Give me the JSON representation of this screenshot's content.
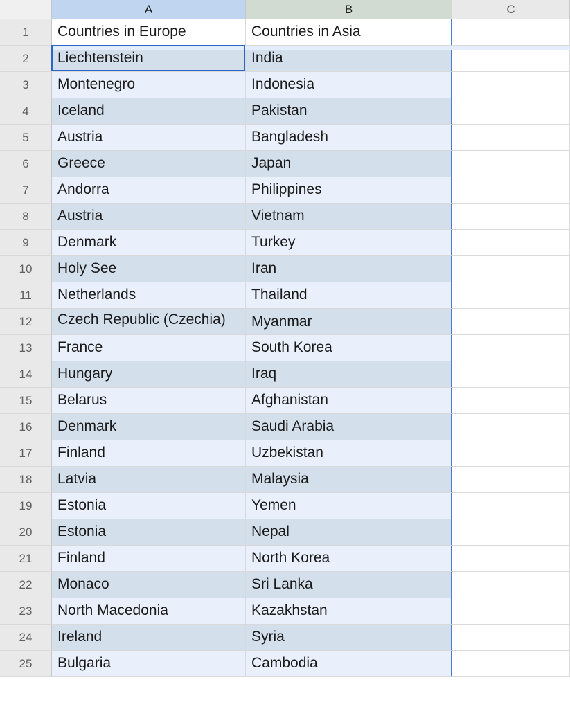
{
  "columns": [
    "A",
    "B",
    "C"
  ],
  "header_row": {
    "a": "Countries in Europe",
    "b": "Countries in Asia",
    "c": ""
  },
  "rows": [
    {
      "n": 2,
      "a": "Liechtenstein",
      "b": "India"
    },
    {
      "n": 3,
      "a": "Montenegro",
      "b": "Indonesia"
    },
    {
      "n": 4,
      "a": "Iceland",
      "b": "Pakistan"
    },
    {
      "n": 5,
      "a": "Austria",
      "b": "Bangladesh"
    },
    {
      "n": 6,
      "a": "Greece",
      "b": "Japan"
    },
    {
      "n": 7,
      "a": "Andorra",
      "b": "Philippines"
    },
    {
      "n": 8,
      "a": "Austria",
      "b": "Vietnam"
    },
    {
      "n": 9,
      "a": "Denmark",
      "b": "Turkey"
    },
    {
      "n": 10,
      "a": "Holy See",
      "b": "Iran"
    },
    {
      "n": 11,
      "a": "Netherlands",
      "b": "Thailand"
    },
    {
      "n": 12,
      "a": "Czech Republic (Czechia)",
      "b": "Myanmar"
    },
    {
      "n": 13,
      "a": "France",
      "b": "South Korea"
    },
    {
      "n": 14,
      "a": "Hungary",
      "b": "Iraq"
    },
    {
      "n": 15,
      "a": "Belarus",
      "b": "Afghanistan"
    },
    {
      "n": 16,
      "a": "Denmark",
      "b": "Saudi Arabia"
    },
    {
      "n": 17,
      "a": "Finland",
      "b": "Uzbekistan"
    },
    {
      "n": 18,
      "a": "Latvia",
      "b": "Malaysia"
    },
    {
      "n": 19,
      "a": "Estonia",
      "b": "Yemen"
    },
    {
      "n": 20,
      "a": "Estonia",
      "b": "Nepal"
    },
    {
      "n": 21,
      "a": "Finland",
      "b": "North Korea"
    },
    {
      "n": 22,
      "a": "Monaco",
      "b": "Sri Lanka"
    },
    {
      "n": 23,
      "a": "North Macedonia",
      "b": "Kazakhstan"
    },
    {
      "n": 24,
      "a": "Ireland",
      "b": "Syria"
    },
    {
      "n": 25,
      "a": "Bulgaria",
      "b": "Cambodia"
    }
  ],
  "active_cell": "A2",
  "selected_range": "A2:B25"
}
